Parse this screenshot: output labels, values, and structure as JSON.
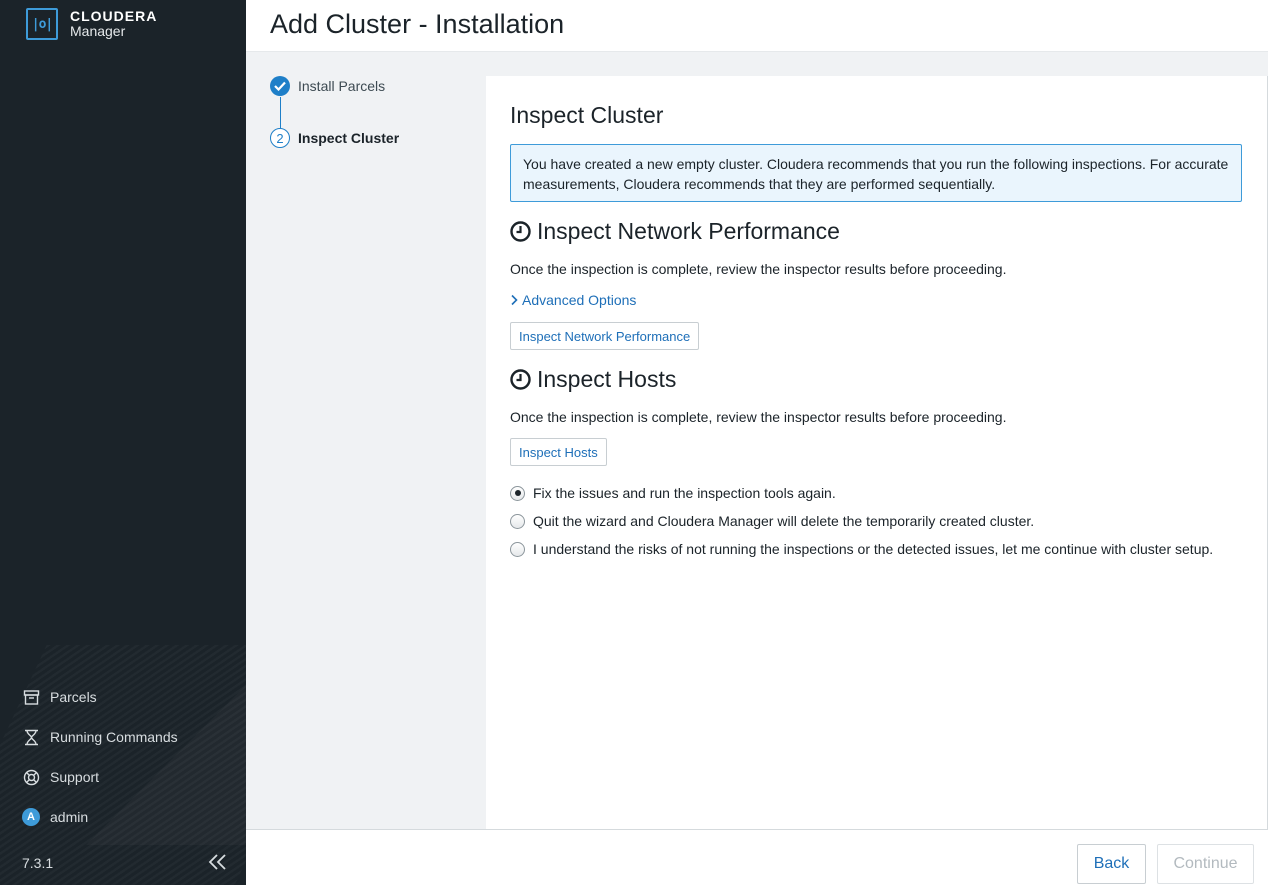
{
  "app": {
    "brand_line1": "CLOUDERA",
    "brand_line2": "Manager",
    "logo_glyph": "|o|",
    "version": "7.3.1"
  },
  "sidebar": {
    "items": [
      {
        "label": "Parcels",
        "icon": "parcel-icon"
      },
      {
        "label": "Running Commands",
        "icon": "hourglass-icon"
      },
      {
        "label": "Support",
        "icon": "lifebuoy-icon"
      },
      {
        "label": "admin",
        "icon": "avatar",
        "avatar_letter": "A"
      }
    ]
  },
  "header": {
    "title": "Add Cluster - Installation"
  },
  "steps": [
    {
      "number": "1",
      "label": "Install Parcels",
      "state": "complete"
    },
    {
      "number": "2",
      "label": "Inspect Cluster",
      "state": "current"
    }
  ],
  "main": {
    "title": "Inspect Cluster",
    "alert": "You have created a new empty cluster. Cloudera recommends that you run the following inspections. For accurate measurements, Cloudera recommends that they are performed sequentially.",
    "network": {
      "title": "Inspect Network Performance",
      "description": "Once the inspection is complete, review the inspector results before proceeding.",
      "advanced_link": "Advanced Options",
      "button": "Inspect Network Performance"
    },
    "hosts": {
      "title": "Inspect Hosts",
      "description": "Once the inspection is complete, review the inspector results before proceeding.",
      "button": "Inspect Hosts"
    },
    "options": [
      {
        "label": "Fix the issues and run the inspection tools again.",
        "selected": true
      },
      {
        "label": "Quit the wizard and Cloudera Manager will delete the temporarily created cluster.",
        "selected": false
      },
      {
        "label": "I understand the risks of not running the inspections or the detected issues, let me continue with cluster setup.",
        "selected": false
      }
    ]
  },
  "footer": {
    "back": "Back",
    "continue": "Continue",
    "continue_disabled": true
  },
  "colors": {
    "sidebar_bg": "#1b2329",
    "accent": "#1e7fc8",
    "link": "#1e6fb8",
    "alert_bg": "#eaf5fd"
  }
}
